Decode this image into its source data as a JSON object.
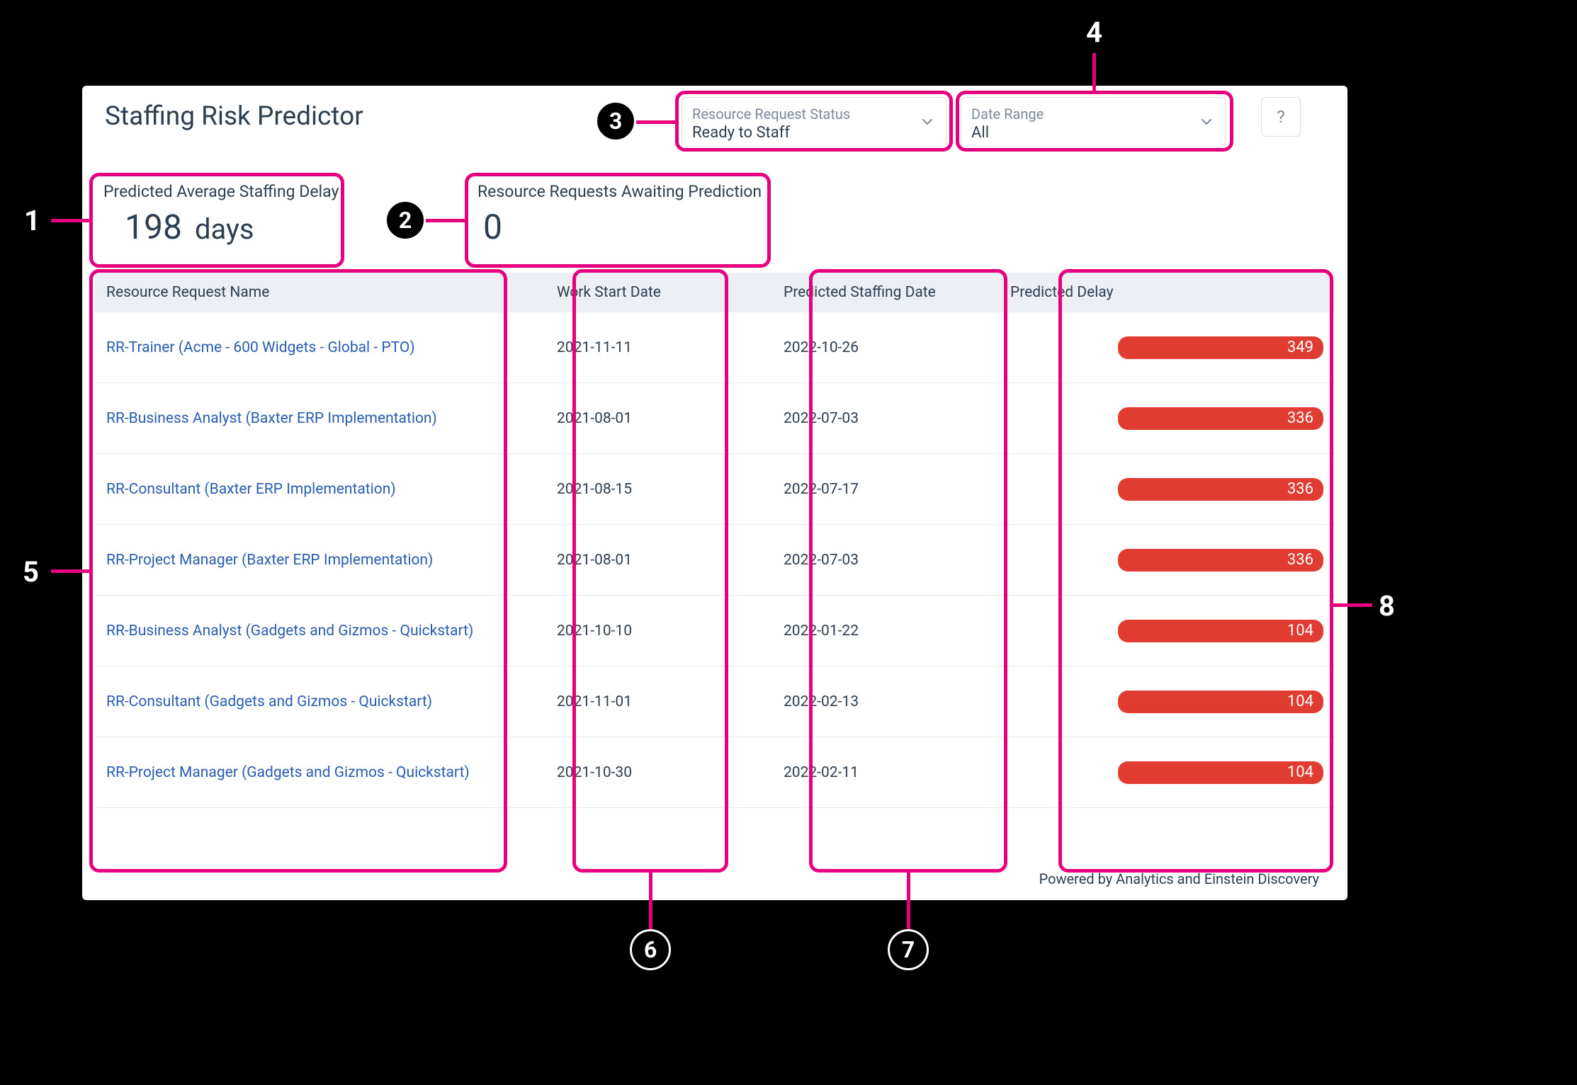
{
  "header": {
    "title": "Staffing Risk Predictor",
    "help_tooltip": "?"
  },
  "filters": {
    "status": {
      "label": "Resource Request Status",
      "value": "Ready to Staff"
    },
    "range": {
      "label": "Date Range",
      "value": "All"
    }
  },
  "metrics": {
    "avg_delay": {
      "label": "Predicted Average Staffing Delay",
      "value": "198",
      "unit": "days"
    },
    "awaiting": {
      "label": "Resource Requests Awaiting Prediction",
      "value": "0"
    }
  },
  "table": {
    "columns": {
      "name": "Resource Request Name",
      "start": "Work Start Date",
      "pred": "Predicted Staffing Date",
      "delay": "Predicted Delay"
    },
    "rows": [
      {
        "name": "RR-Trainer (Acme - 600 Widgets - Global - PTO)",
        "start": "2021-11-11",
        "pred": "2022-10-26",
        "delay": "349"
      },
      {
        "name": "RR-Business Analyst (Baxter ERP Implementation)",
        "start": "2021-08-01",
        "pred": "2022-07-03",
        "delay": "336"
      },
      {
        "name": "RR-Consultant (Baxter ERP Implementation)",
        "start": "2021-08-15",
        "pred": "2022-07-17",
        "delay": "336"
      },
      {
        "name": "RR-Project Manager (Baxter ERP Implementation)",
        "start": "2021-08-01",
        "pred": "2022-07-03",
        "delay": "336"
      },
      {
        "name": "RR-Business Analyst (Gadgets and Gizmos - Quickstart)",
        "start": "2021-10-10",
        "pred": "2022-01-22",
        "delay": "104"
      },
      {
        "name": "RR-Consultant (Gadgets and Gizmos - Quickstart)",
        "start": "2021-11-01",
        "pred": "2022-02-13",
        "delay": "104"
      },
      {
        "name": "RR-Project Manager (Gadgets and Gizmos - Quickstart)",
        "start": "2021-10-30",
        "pred": "2022-02-11",
        "delay": "104"
      }
    ]
  },
  "footer": {
    "powered_by": "Powered by Analytics and Einstein Discovery"
  },
  "annotations": {
    "n1": "1",
    "n2": "2",
    "n3": "3",
    "n4": "4",
    "n5": "5",
    "n6": "6",
    "n7": "7",
    "n8": "8"
  }
}
